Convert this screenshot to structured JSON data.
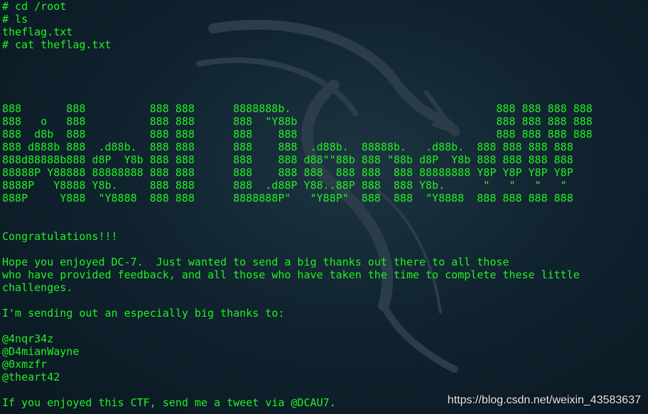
{
  "terminal": {
    "lines": [
      "# cd /root",
      "# ls",
      "theflag.txt",
      "# cat theflag.txt",
      "",
      "",
      "",
      "",
      "888       888          888 888      8888888b.                                888 888 888 888",
      "888   o   888          888 888      888  \"Y88b                               888 888 888 888",
      "888  d8b  888          888 888      888    888                               888 888 888 888",
      "888 d888b 888  .d88b.  888 888      888    888  .d88b.  88888b.   .d88b.  888 888 888 888",
      "888d88888b888 d8P  Y8b 888 888      888    888 d88\"\"88b 888 \"88b d8P  Y8b 888 888 888 888",
      "88888P Y88888 88888888 888 888      888    888 888  888 888  888 88888888 Y8P Y8P Y8P Y8P",
      "8888P   Y8888 Y8b.     888 888      888  .d88P Y88..88P 888  888 Y8b.      \"   \"   \"   \"",
      "888P     Y888  \"Y8888  888 888      8888888P\"   \"Y88P\"  888  888  \"Y8888  888 888 888 888",
      "",
      "",
      "Congratulations!!!",
      "",
      "Hope you enjoyed DC-7.  Just wanted to send a big thanks out there to all those",
      "who have provided feedback, and all those who have taken the time to complete these little",
      "challenges.",
      "",
      "I'm sending out an especially big thanks to:",
      "",
      "@4nqr34z",
      "@D4mianWayne",
      "@0xmzfr",
      "@theart42",
      "",
      "If you enjoyed this CTF, send me a tweet via @DCAU7."
    ]
  },
  "watermark": "https://blog.csdn.net/weixin_43583637",
  "colors": {
    "text": "#22f022",
    "background": "#10232f"
  }
}
